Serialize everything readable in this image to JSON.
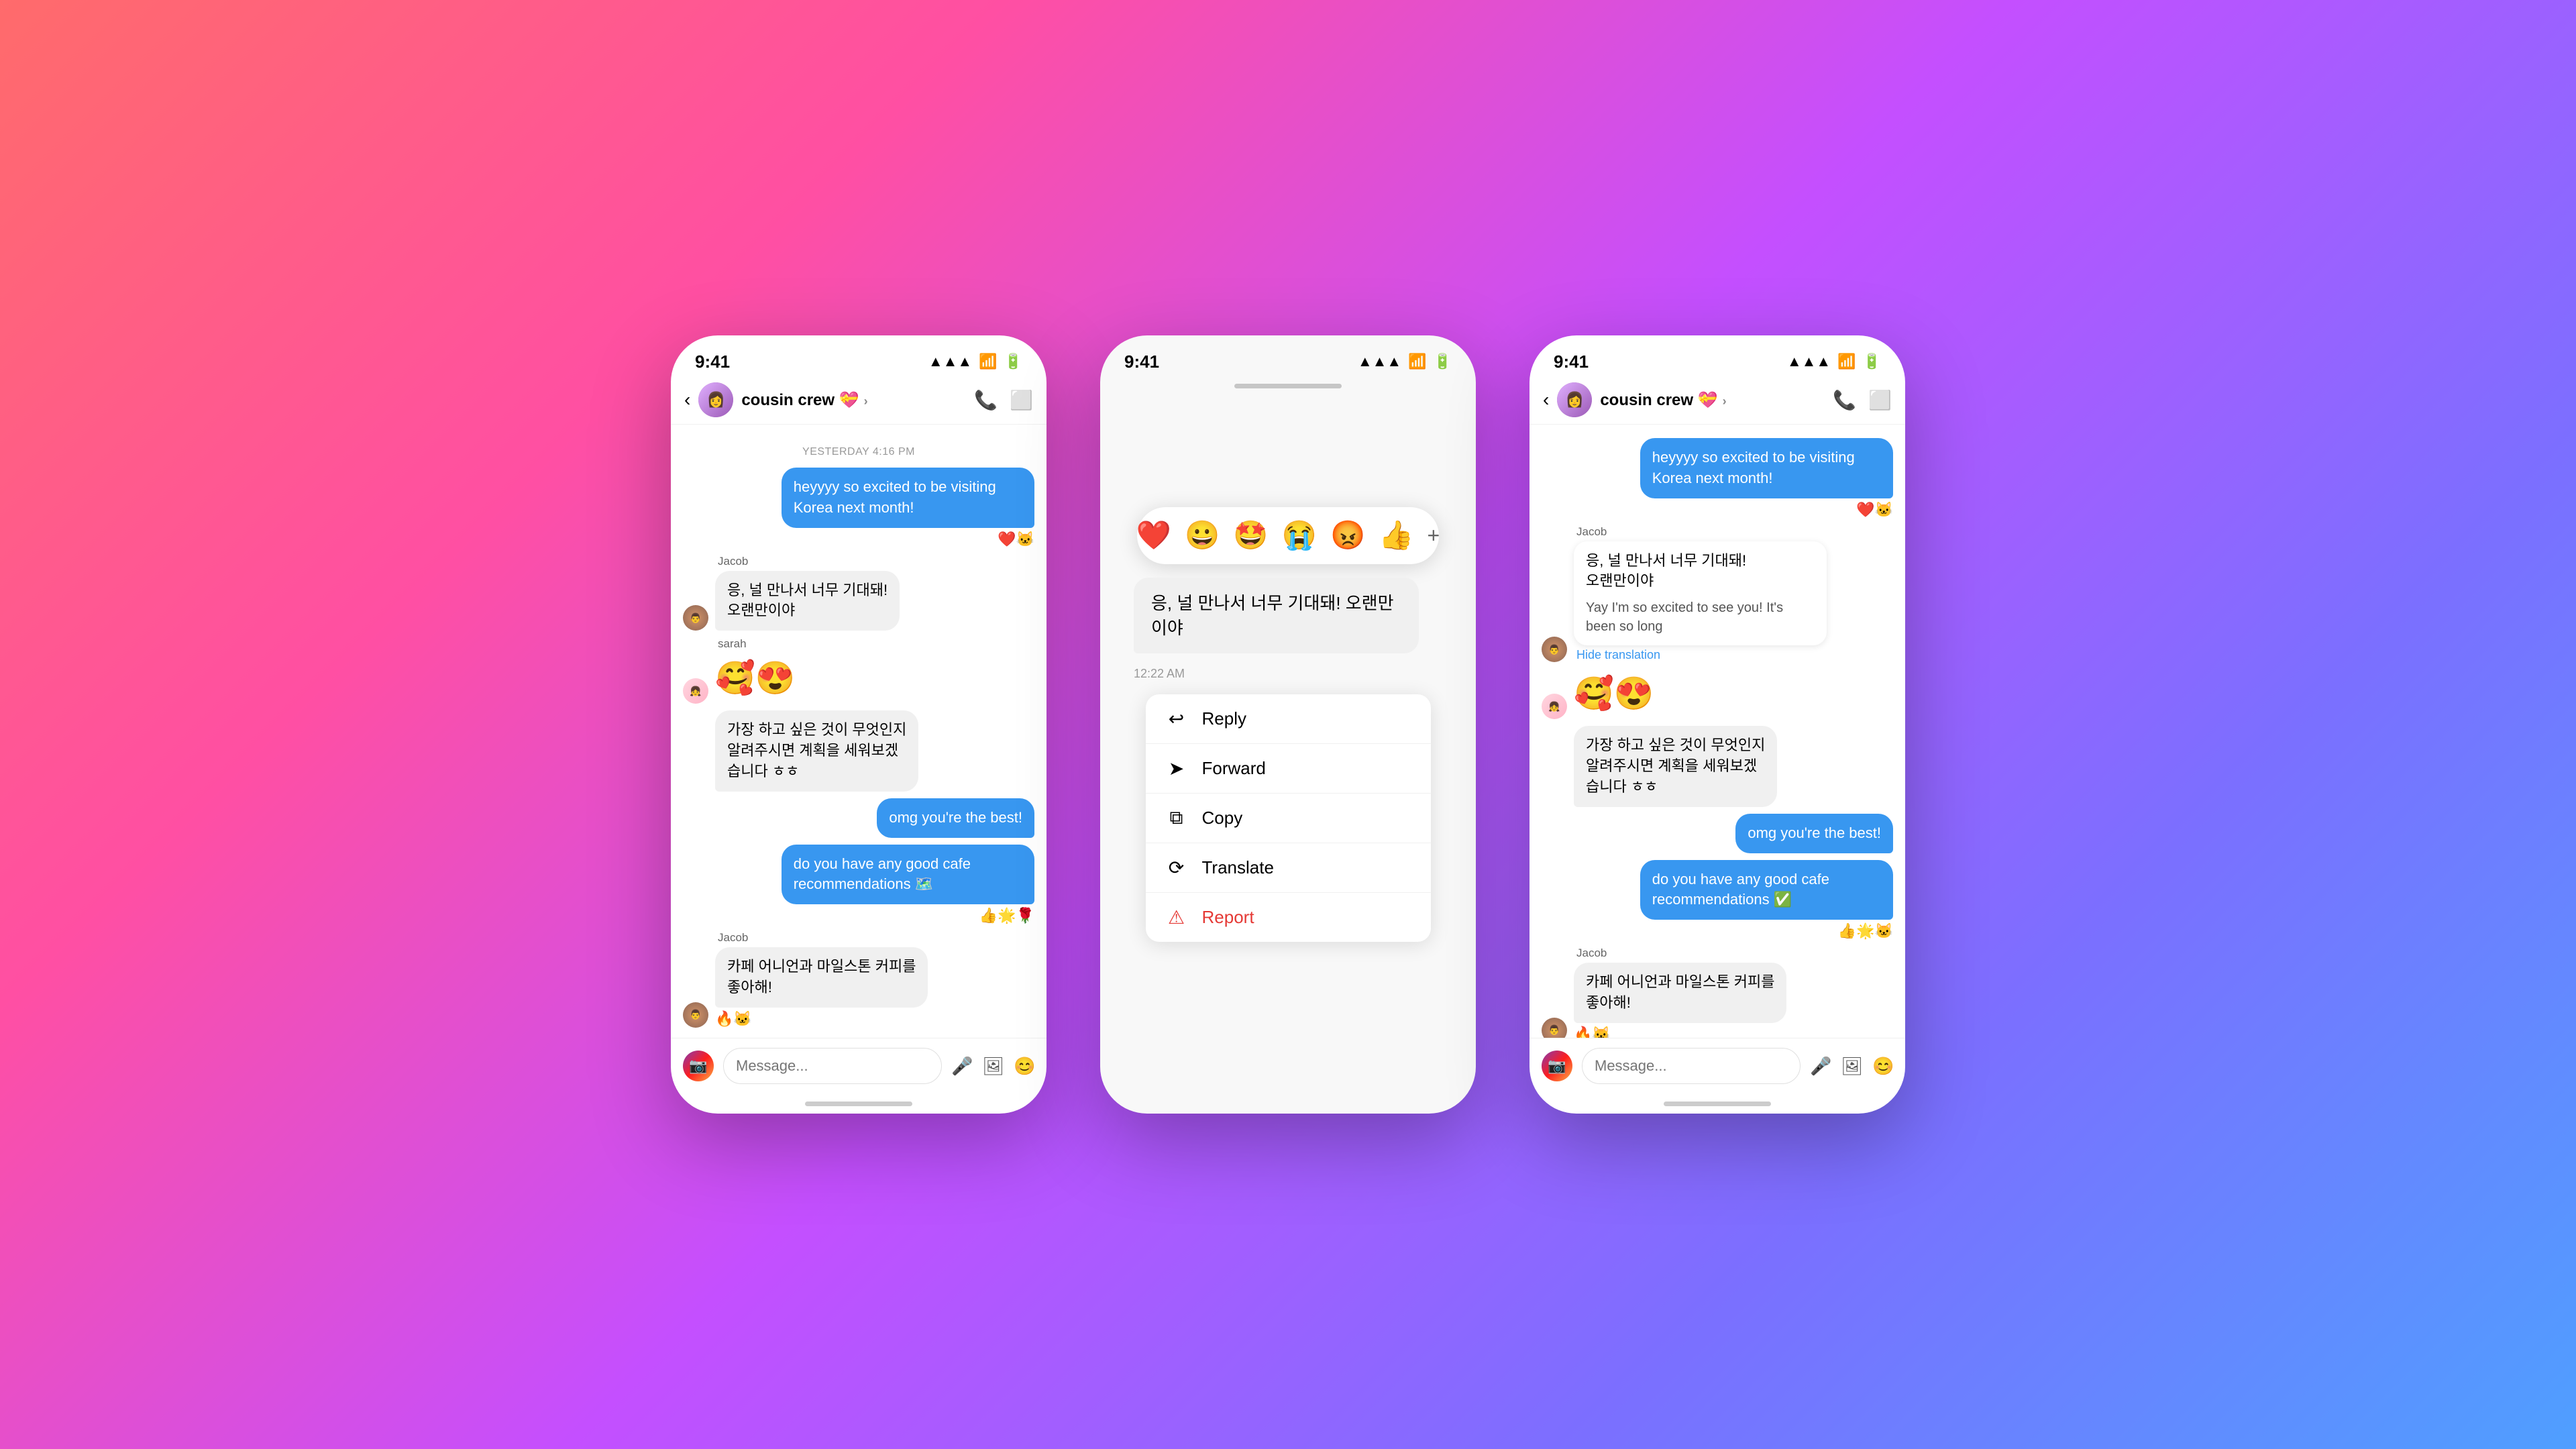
{
  "phone1": {
    "status_time": "9:41",
    "header_title": "cousin crew 💝",
    "date_separator": "YESTERDAY 4:16 PM",
    "messages": [
      {
        "id": "m1",
        "type": "sent",
        "text": "heyyyy so excited to be visiting Korea next month!",
        "reactions": "❤️🐱"
      },
      {
        "id": "m2",
        "type": "received",
        "sender": "Jacob",
        "text": "응, 널 만나서 너무 기대돼!\n오랜만이야"
      },
      {
        "id": "m3",
        "type": "received-emoji",
        "sender": "sarah",
        "text": "🥰😍"
      },
      {
        "id": "m4",
        "type": "received",
        "text": "가장 하고 싶은 것이 무엇인지\n알려주시면 계획을 세워보겠\n습니다 ㅎㅎ"
      },
      {
        "id": "m5",
        "type": "sent",
        "text": "omg you're the best!"
      },
      {
        "id": "m6",
        "type": "sent",
        "text": "do you have any good cafe recommendations 🗺️",
        "reactions": "👍🌟🌹"
      },
      {
        "id": "m7",
        "type": "received",
        "sender": "Jacob",
        "text": "카페 어니언과 마일스톤 커피를\n좋아해!",
        "reactions": "🔥🐱"
      }
    ],
    "input_placeholder": "Message..."
  },
  "phone2": {
    "status_time": "9:41",
    "context_message": "응, 널 만나서 너무 기대돼!\n오랜만이야",
    "context_time": "12:22 AM",
    "emoji_reactions": [
      "❤️",
      "😀",
      "🤩",
      "😭",
      "😡",
      "👍"
    ],
    "menu_items": [
      {
        "icon": "↩",
        "label": "Reply",
        "danger": false
      },
      {
        "icon": "➤",
        "label": "Forward",
        "danger": false
      },
      {
        "icon": "⧉",
        "label": "Copy",
        "danger": false
      },
      {
        "icon": "⟳",
        "label": "Translate",
        "danger": false
      },
      {
        "icon": "⚠",
        "label": "Report",
        "danger": true
      }
    ]
  },
  "phone3": {
    "status_time": "9:41",
    "header_title": "cousin crew 💝",
    "messages": [
      {
        "id": "p3m1",
        "type": "sent",
        "text": "heyyyy so excited to be visiting Korea next month!",
        "reactions": "❤️🐱"
      },
      {
        "id": "p3m2",
        "type": "received",
        "sender": "Jacob",
        "text": "응, 널 만나서 너무 기대돼!\n오랜만이야",
        "translation": "Yay I'm so excited to see you! It's been so long",
        "show_hide_translation": "Hide translation"
      },
      {
        "id": "p3m3",
        "type": "received-emoji",
        "sender": "sarah",
        "text": "🥰😍"
      },
      {
        "id": "p3m4",
        "type": "received",
        "text": "가장 하고 싶은 것이 무엇인지\n알려주시면 계획을 세워보겠\n습니다 ㅎㅎ"
      },
      {
        "id": "p3m5",
        "type": "sent",
        "text": "omg you're the best!"
      },
      {
        "id": "p3m6",
        "type": "sent",
        "text": "do you have any good cafe recommendations ✅",
        "reactions": "👍🌟🐱"
      },
      {
        "id": "p3m7",
        "type": "received",
        "sender": "Jacob",
        "text": "카페 어니언과 마일스톤 커피를\n좋아해!",
        "reactions": "🔥🐱"
      }
    ],
    "input_placeholder": "Message..."
  },
  "icons": {
    "back": "‹",
    "phone": "📞",
    "video": "📹",
    "mic": "🎤",
    "image": "🖼",
    "emoji": "😊",
    "plus": "⊕",
    "camera": "📷"
  }
}
